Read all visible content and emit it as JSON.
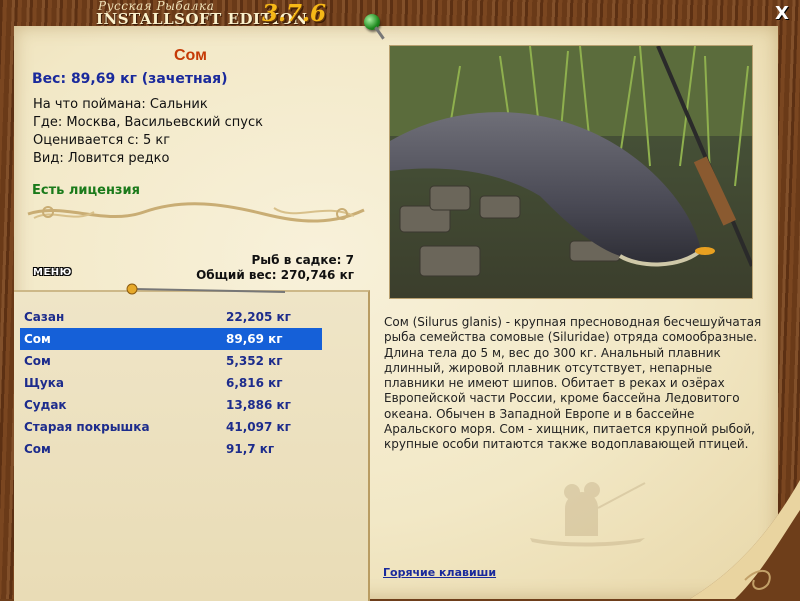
{
  "app": {
    "title_small": "Русская Рыбалка",
    "title_main": "INSTALLSOFT EDITION",
    "version": "3.7.6",
    "close_label": "X"
  },
  "fish": {
    "name": "Сом",
    "weight": "Вес: 89,69 кг (зачетная)",
    "caught_on": "На что поймана: Сальник",
    "where": "Где: Москва, Васильевский спуск",
    "rated_from": "Оценивается с: 5 кг",
    "kind": "Вид: Ловится редко",
    "license": "Есть лицензия"
  },
  "keepnet": {
    "count": "Рыб в садке: 7",
    "total": "Общий вес: 270,746 кг"
  },
  "menu_label": "МЕНЮ",
  "catch_list": [
    {
      "name": "Сазан",
      "weight": "22,205 кг"
    },
    {
      "name": "Сом",
      "weight": "89,69 кг"
    },
    {
      "name": "Сом",
      "weight": "5,352 кг"
    },
    {
      "name": "Щука",
      "weight": "6,816 кг"
    },
    {
      "name": "Судак",
      "weight": "13,886 кг"
    },
    {
      "name": "Старая покрышка",
      "weight": "41,097 кг"
    },
    {
      "name": "Сом",
      "weight": "91,7 кг"
    }
  ],
  "selected_index": 1,
  "description": "Сом (Silurus glanis) - крупная пресноводная бесчешуйчатая рыба семейства сомовые (Siluridae) отряда сомообразные. Длина тела до 5 м, вес до 300 кг. Анальный плавник длинный, жировой плавник отсутствует, непарные плавники не имеют шипов. Обитает в реках и озёрах Европейской части России, кроме бассейна Ледовитого океана. Обычен в Западной Европе и в бассейне Аральского моря. Сом - хищник, питается крупной рыбой, крупные особи питаются также водоплавающей птицей.",
  "hotkeys_label": "Горячие клавиши",
  "colors": {
    "title_red": "#c53a06",
    "weight_blue": "#1a2a9c",
    "license_green": "#1a7a1a",
    "selection": "#1560d8"
  }
}
